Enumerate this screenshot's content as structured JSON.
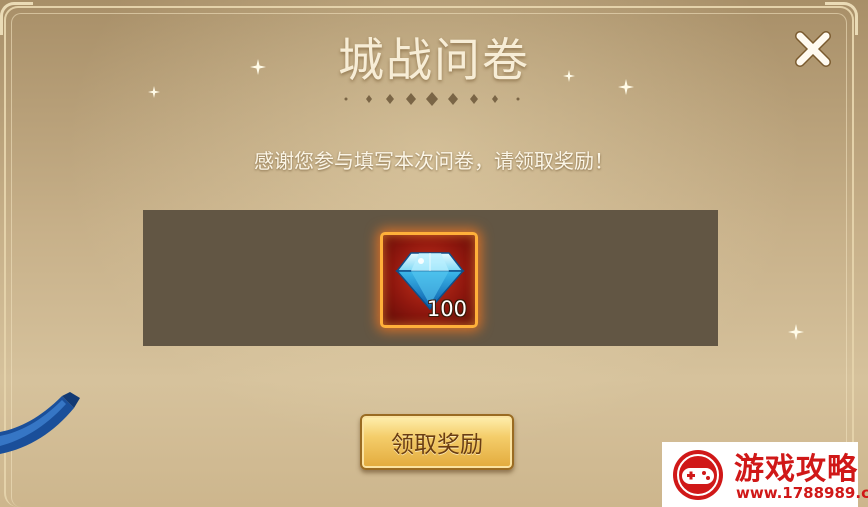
{
  "dialog": {
    "title": "城战问卷",
    "message": "感谢您参与填写本次问卷，请领取奖励！",
    "close_icon": "close-icon"
  },
  "rewards": [
    {
      "icon": "diamond-icon",
      "count": "100"
    }
  ],
  "claim_button": {
    "label": "领取奖励"
  },
  "watermark": {
    "title": "游戏攻略",
    "url": "www.1788989.com"
  },
  "colors": {
    "accent_gold": "#f4cd6a",
    "panel_bg": "#c7b089",
    "reward_bg": "#625644",
    "item_border": "#ffb03a"
  }
}
